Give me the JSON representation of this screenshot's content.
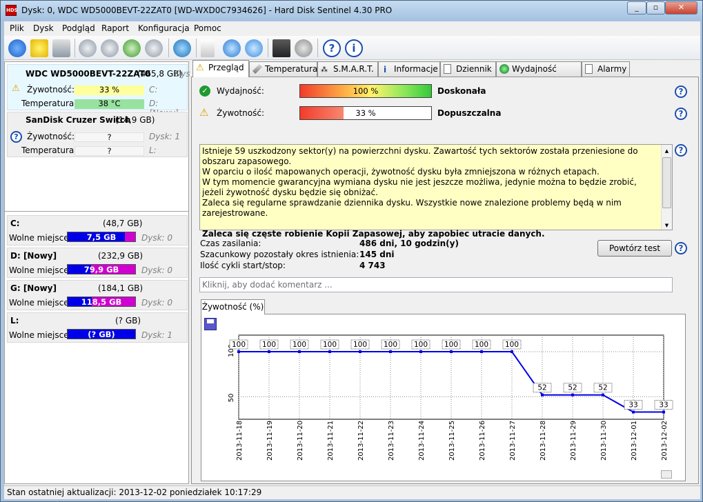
{
  "window": {
    "title": "Dysk: 0, WDC WD5000BEVT-22ZAT0 [WD-WXD0C7934626]  -  Hard Disk Sentinel 4.30 PRO"
  },
  "menu": [
    "Plik",
    "Dysk",
    "Podgląd",
    "Raport",
    "Konfiguracja",
    "Pomoc"
  ],
  "toolbar_icons": [
    "refresh-icon",
    "warning-icon",
    "drive-icon",
    "network-icon",
    "network-icon",
    "network-ok-icon",
    "network-icon",
    "globe-icon",
    "document-icon",
    "sync-icon",
    "tools-icon",
    "monitor-icon",
    "speaker-icon",
    "help-icon",
    "info-icon"
  ],
  "disks": [
    {
      "name": "WDC WD5000BEVT-22ZAT0",
      "size": "(465,8 GB)",
      "disk_label": "Dys",
      "health_label": "Żywotność:",
      "health": "33 %",
      "health_color": "#ffff9c",
      "temp_label": "Temperatura:",
      "temp": "38 °C",
      "temp_color": "#96e29e",
      "part1": "C:",
      "part2": "D: [Nowy],"
    },
    {
      "name": "SanDisk Cruzer Switch",
      "size": "(14,9 GB)",
      "disk_label": "Dysk: 1",
      "health_label": "Żywotność:",
      "health": "?",
      "temp_label": "Temperatura:",
      "temp": "?",
      "part1": "L:"
    }
  ],
  "partitions": [
    {
      "name": "C:",
      "size": "(48,7 GB)",
      "free_label": "Wolne miejsce",
      "free": "7,5 GB",
      "free_fraction": 0.85,
      "disk": "Dysk: 0"
    },
    {
      "name": "D: [Nowy]",
      "size": "(232,9 GB)",
      "free_label": "Wolne miejsce",
      "free": "79,9 GB",
      "free_fraction": 0.35,
      "disk": "Dysk: 0"
    },
    {
      "name": "G: [Nowy]",
      "size": "(184,1 GB)",
      "free_label": "Wolne miejsce",
      "free": "118,5 GB",
      "free_fraction": 0.36,
      "disk": "Dysk: 0"
    },
    {
      "name": "L:",
      "size": "(? GB)",
      "free_label": "Wolne miejsce",
      "free": "(? GB)",
      "free_fraction": 0,
      "disk": "Dysk: 1"
    }
  ],
  "tabs": [
    "Przegląd",
    "Temperatura",
    "S.M.A.R.T.",
    "Informacje",
    "Dziennik",
    "Wydajność dysku",
    "Alarmy"
  ],
  "overview": {
    "performance_label": "Wydajność:",
    "performance": "100 %",
    "performance_value": 100,
    "performance_rating": "Doskonała",
    "health_label": "Żywotność:",
    "health": "33 %",
    "health_value": 33,
    "health_rating": "Dopuszczalna",
    "message_lines": [
      "Istnieje 59 uszkodzony sektor(y) na powierzchni dysku. Zawartość tych sektorów została przeniesione do obszaru zapasowego.",
      "W oparciu o ilość mapowanych operacji, żywotność dysku była zmniejszona w różnych etapach.",
      "W tym momencie gwarancyjna wymiana dysku nie jest jeszcze możliwa, jedynie można to będzie zrobić, jeżeli żywotność dysku będzie się obniżać.",
      "Zaleca się regularne sprawdzanie dziennika dysku. Wszystkie nowe znalezione problemy będą w nim zarejestrowane."
    ],
    "message_bold": "Zaleca się częste robienie Kopii Zapasowej, aby zapobiec utracie danych.",
    "power_on_label": "Czas zasilania:",
    "power_on": "486 dni, 10 godzin(y)",
    "remaining_label": "Szacunkowy pozostały okres istnienia:",
    "remaining": "145 dni",
    "cycles_label": "Ilość cykli start/stop:",
    "cycles": "4 743",
    "retest_button": "Powtórz test",
    "comment_placeholder": "Kliknij, aby dodać komentarz ..."
  },
  "chart_tab": "Żywotność (%)",
  "chart_data": {
    "type": "line",
    "x": [
      "2013-11-18",
      "2013-11-19",
      "2013-11-20",
      "2013-11-21",
      "2013-11-22",
      "2013-11-23",
      "2013-11-24",
      "2013-11-25",
      "2013-11-26",
      "2013-11-27",
      "2013-11-28",
      "2013-11-29",
      "2013-11-30",
      "2013-12-01",
      "2013-12-02"
    ],
    "series": [
      {
        "values": [
          100,
          100,
          100,
          100,
          100,
          100,
          100,
          100,
          100,
          100,
          52,
          52,
          52,
          33,
          33
        ]
      }
    ],
    "yticks": [
      50,
      100
    ],
    "color": "#0000e6",
    "grid": true
  },
  "status": "Stan ostatniej aktualizacji: 2013-12-02 poniedziałek 10:17:29"
}
